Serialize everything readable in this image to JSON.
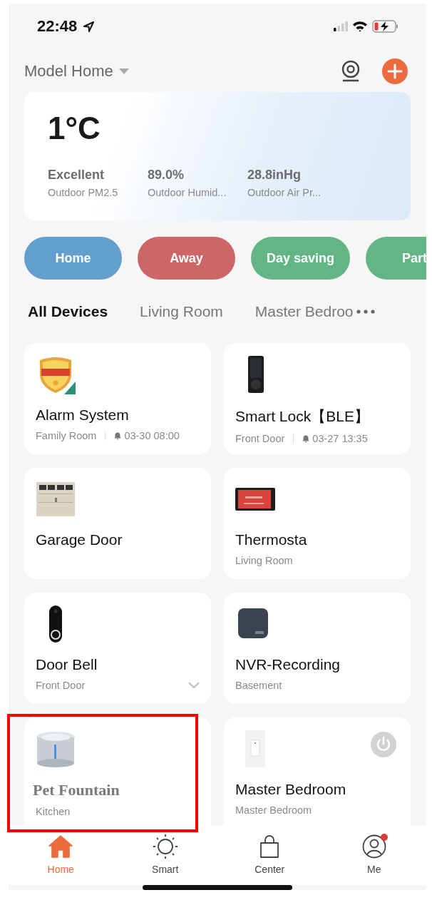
{
  "status_bar": {
    "time": "22:48"
  },
  "header": {
    "home_name": "Model Home"
  },
  "weather": {
    "temperature": "1°C",
    "metrics": [
      {
        "value": "Excellent",
        "label": "Outdoor PM2.5"
      },
      {
        "value": "89.0%",
        "label": "Outdoor Humid..."
      },
      {
        "value": "28.8inHg",
        "label": "Outdoor Air Pr..."
      }
    ]
  },
  "scenes": [
    {
      "label": "Home",
      "color": "#639fcd"
    },
    {
      "label": "Away",
      "color": "#cd6767"
    },
    {
      "label": "Day saving",
      "color": "#63b585"
    },
    {
      "label": "Part",
      "color": "#63b585"
    }
  ],
  "room_tabs": [
    {
      "label": "All Devices",
      "selected": true
    },
    {
      "label": "Living Room",
      "selected": false
    },
    {
      "label": "Master Bedroo",
      "selected": false
    }
  ],
  "devices": [
    {
      "name": "Alarm System",
      "room": "Family Room",
      "alert_time": "03-30 08:00"
    },
    {
      "name": "Smart Lock【BLE】",
      "room": "Front Door",
      "alert_time": "03-27 13:35"
    },
    {
      "name": "Garage Door"
    },
    {
      "name": "Thermosta",
      "room": "Living Room"
    },
    {
      "name": "Door Bell",
      "room": "Front Door",
      "expandable": true
    },
    {
      "name": "NVR-Recording",
      "room": "Basement"
    },
    {
      "name": "Pet Fountain",
      "room": "Kitchen",
      "annotated": true
    },
    {
      "name": "Master Bedroom",
      "room": "Master Bedroom",
      "power_button": true
    }
  ],
  "bottom_nav": [
    {
      "label": "Home",
      "selected": true,
      "badge": false
    },
    {
      "label": "Smart",
      "selected": false,
      "badge": false
    },
    {
      "label": "Center",
      "selected": false,
      "badge": false
    },
    {
      "label": "Me",
      "selected": false,
      "badge": true
    }
  ]
}
